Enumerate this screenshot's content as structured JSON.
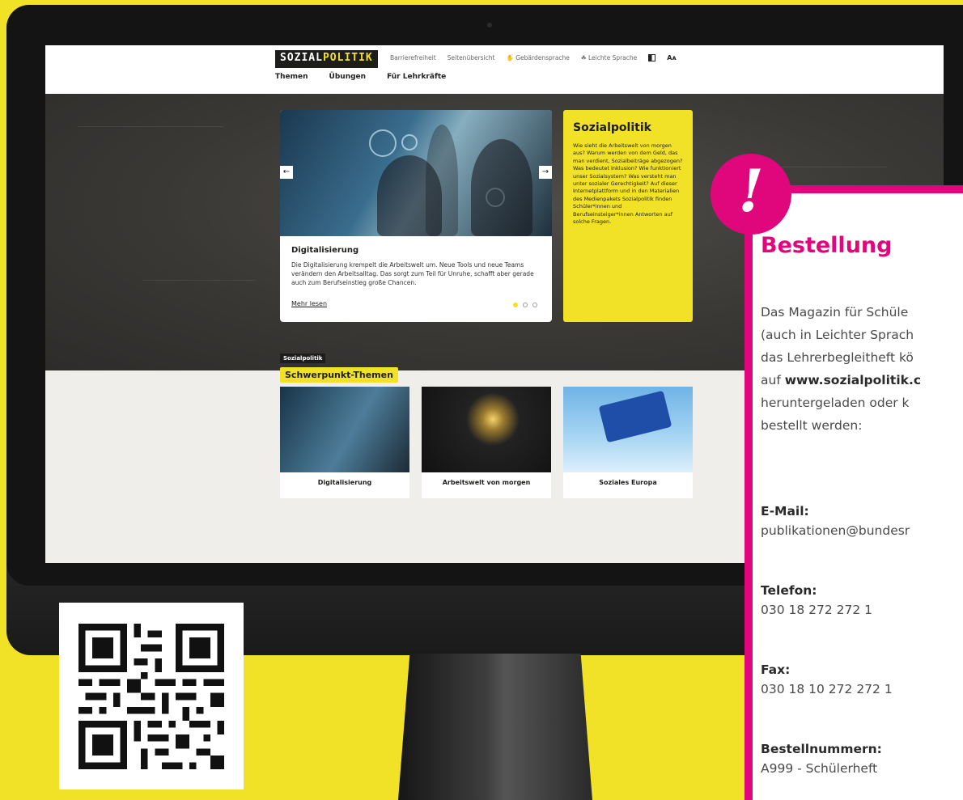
{
  "colors": {
    "accent_yellow": "#f2e227",
    "accent_pink": "#e0077d",
    "dark": "#1d1d1b"
  },
  "site": {
    "logo_part1": "SOZIAL",
    "logo_part2": "POLITIK",
    "util_nav": [
      "Barrierefreiheit",
      "Seitenübersicht",
      "Gebärdensprache",
      "Leichte Sprache",
      "Aᴀ"
    ],
    "main_nav": [
      "Themen",
      "Übungen",
      "Für Lehrkräfte"
    ]
  },
  "slider": {
    "title": "Digitalisierung",
    "text": "Die Digitalisierung krempelt die Arbeitswelt um. Neue Tools und neue Teams verändern den Arbeitsalltag. Das sorgt zum Teil für Unruhe, schafft aber gerade auch zum Berufseinstieg große Chancen.",
    "link": "Mehr lesen",
    "prev_icon": "←",
    "next_icon": "→"
  },
  "intro_panel": {
    "title": "Sozialpolitik",
    "text": "Wie sieht die Arbeitswelt von morgen aus? Warum werden von dem Geld, das man verdient, Sozialbeiträge abgezogen? Was bedeutet Inklusion? Wie funktioniert unser Sozialsystem? Was versteht man unter sozialer Gerechtigkeit? Auf dieser Internetplattform und in den Materialien des Medienpakets Sozialpolitik finden Schüler*innen und Berufseinsteiger*innen Antworten auf solche Fragen."
  },
  "section": {
    "tag": "Sozialpolitik",
    "title": "Schwerpunkt-Themen",
    "topics": [
      "Digitalisierung",
      "Arbeitswelt von morgen",
      "Soziales Europa"
    ]
  },
  "order": {
    "exclaim": "!",
    "title": "Bestellung",
    "text_lines": [
      "Das Magazin für Schüle",
      "(auch in Leichter Sprach",
      "das Lehrerbegleitheft kö"
    ],
    "text_line4_prefix": "auf ",
    "text_line4_bold": "www.sozialpolitik.c",
    "text_lines_end": [
      "heruntergeladen oder k",
      "bestellt werden:"
    ],
    "email_label": "E-Mail:",
    "email_value": "publikationen@bundesr",
    "phone_label": "Telefon:",
    "phone_value": "030 18 272 272 1",
    "fax_label": "Fax:",
    "fax_value": "030 18 10 272 272 1",
    "order_no_label": "Bestellnummern:",
    "order_no_value": "A999 - Schülerheft"
  }
}
